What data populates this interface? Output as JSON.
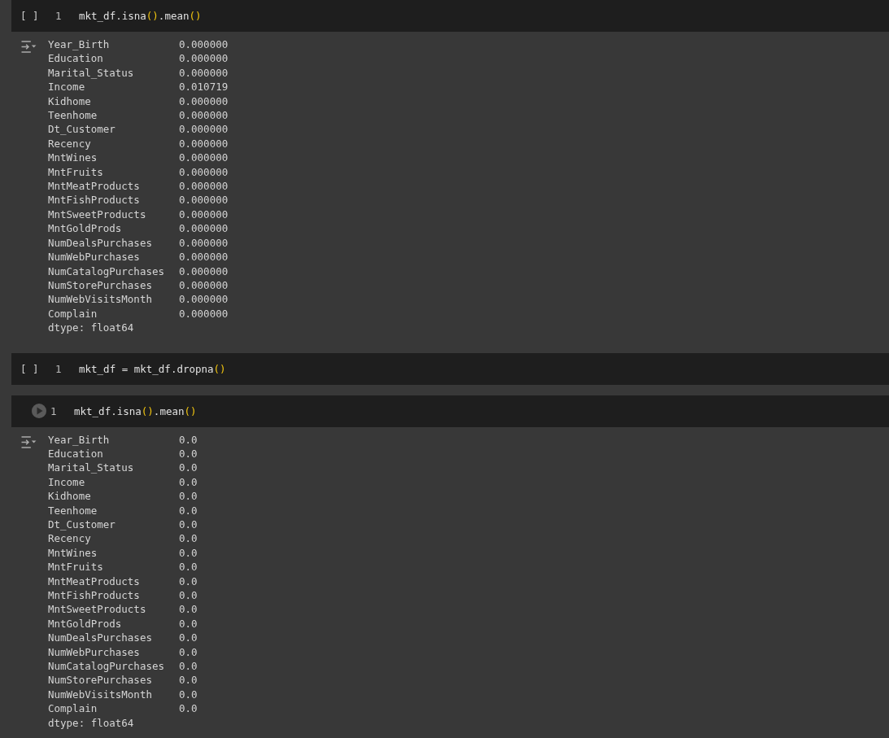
{
  "cells": [
    {
      "prompt": {
        "kind": "brackets",
        "text": "[ ]"
      },
      "line_number": "1",
      "code": [
        {
          "kind": "plain",
          "text": "mkt_df.isna"
        },
        {
          "kind": "bracket",
          "text": "()"
        },
        {
          "kind": "plain",
          "text": ".mean"
        },
        {
          "kind": "bracket",
          "text": "()"
        }
      ],
      "output": {
        "rows": [
          {
            "name": "Year_Birth",
            "value": "0.000000"
          },
          {
            "name": "Education",
            "value": "0.000000"
          },
          {
            "name": "Marital_Status",
            "value": "0.000000"
          },
          {
            "name": "Income",
            "value": "0.010719"
          },
          {
            "name": "Kidhome",
            "value": "0.000000"
          },
          {
            "name": "Teenhome",
            "value": "0.000000"
          },
          {
            "name": "Dt_Customer",
            "value": "0.000000"
          },
          {
            "name": "Recency",
            "value": "0.000000"
          },
          {
            "name": "MntWines",
            "value": "0.000000"
          },
          {
            "name": "MntFruits",
            "value": "0.000000"
          },
          {
            "name": "MntMeatProducts",
            "value": "0.000000"
          },
          {
            "name": "MntFishProducts",
            "value": "0.000000"
          },
          {
            "name": "MntSweetProducts",
            "value": "0.000000"
          },
          {
            "name": "MntGoldProds",
            "value": "0.000000"
          },
          {
            "name": "NumDealsPurchases",
            "value": "0.000000"
          },
          {
            "name": "NumWebPurchases",
            "value": "0.000000"
          },
          {
            "name": "NumCatalogPurchases",
            "value": "0.000000"
          },
          {
            "name": "NumStorePurchases",
            "value": "0.000000"
          },
          {
            "name": "NumWebVisitsMonth",
            "value": "0.000000"
          },
          {
            "name": "Complain",
            "value": "0.000000"
          }
        ],
        "dtype": "dtype: float64"
      }
    },
    {
      "prompt": {
        "kind": "brackets",
        "text": "[ ]"
      },
      "line_number": "1",
      "code": [
        {
          "kind": "plain",
          "text": "mkt_df = mkt_df.dropna"
        },
        {
          "kind": "bracket",
          "text": "()"
        }
      ]
    },
    {
      "prompt": {
        "kind": "run"
      },
      "line_number": "1",
      "code": [
        {
          "kind": "plain",
          "text": "mkt_df.isna"
        },
        {
          "kind": "bracket",
          "text": "()"
        },
        {
          "kind": "plain",
          "text": ".mean"
        },
        {
          "kind": "bracket",
          "text": "()"
        }
      ],
      "output": {
        "rows": [
          {
            "name": "Year_Birth",
            "value": "0.0"
          },
          {
            "name": "Education",
            "value": "0.0"
          },
          {
            "name": "Marital_Status",
            "value": "0.0"
          },
          {
            "name": "Income",
            "value": "0.0"
          },
          {
            "name": "Kidhome",
            "value": "0.0"
          },
          {
            "name": "Teenhome",
            "value": "0.0"
          },
          {
            "name": "Dt_Customer",
            "value": "0.0"
          },
          {
            "name": "Recency",
            "value": "0.0"
          },
          {
            "name": "MntWines",
            "value": "0.0"
          },
          {
            "name": "MntFruits",
            "value": "0.0"
          },
          {
            "name": "MntMeatProducts",
            "value": "0.0"
          },
          {
            "name": "MntFishProducts",
            "value": "0.0"
          },
          {
            "name": "MntSweetProducts",
            "value": "0.0"
          },
          {
            "name": "MntGoldProds",
            "value": "0.0"
          },
          {
            "name": "NumDealsPurchases",
            "value": "0.0"
          },
          {
            "name": "NumWebPurchases",
            "value": "0.0"
          },
          {
            "name": "NumCatalogPurchases",
            "value": "0.0"
          },
          {
            "name": "NumStorePurchases",
            "value": "0.0"
          },
          {
            "name": "NumWebVisitsMonth",
            "value": "0.0"
          },
          {
            "name": "Complain",
            "value": "0.0"
          }
        ],
        "dtype": "dtype: float64"
      }
    }
  ]
}
